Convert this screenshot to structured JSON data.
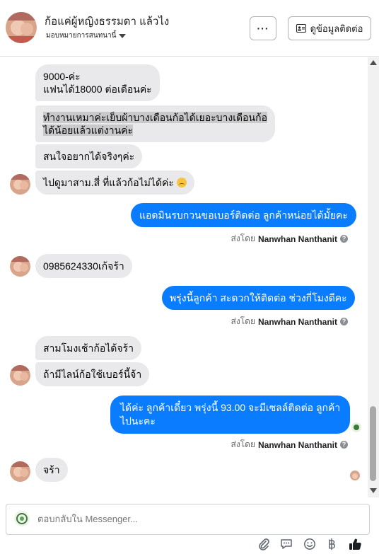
{
  "header": {
    "name": "ก้อแค่ผู้หญิงธรรมดา แล้วไง",
    "subtitle": "มอบหมายการสนทนานี้",
    "more_label": "···",
    "contact_label": "ดูข้อมูลติดต่อ"
  },
  "messages": {
    "m1_line1": "9000-ค่ะ",
    "m1_line2": "แฟนได้18000 ต่อเดือนค่ะ",
    "m2_line1": "ทำงานเหมาค่ะเย็บผ้าบางเดือนก้อได้เยอะบางเดือนก้อ",
    "m2_line2": "ได้น้อยแล้วแต่งานค่ะ",
    "m3": "สนใจอยากได้จริงๆค่ะ",
    "m4": "ไปดูมาสาม.สี่  ที่แล้วก้อไม่ได้ค่ะ",
    "m5": "แอดมินรบกวนขอเบอร์ติดต่อ ลูกค้าหน่อยได้มั้ยคะ",
    "m6": "0985624330เก้จร้า",
    "m7": "พรุ่งนี้ลูกค้า สะดวกให้ติดต่อ ช่วงกี่โมงดีคะ",
    "m8": "สามโมงเช้าก้อได้จร้า",
    "m9": "ถ้ามีไลน์ก้อใช้เบอร์นี้จ้า",
    "m10_line1": "ได้ค่ะ ลูกค้าเดี๋ยว  พรุ่งนี้ 93.00 จะมีเซลล์ติดต่อ ลูกค้า",
    "m10_line2": "ไปนะคะ",
    "m11": "จร้า"
  },
  "sent_by": {
    "prefix": "ส่งโดย",
    "name": "Nanwhan Nanthanit"
  },
  "composer": {
    "placeholder": "ตอบกลับใน Messenger..."
  },
  "icons": {
    "attach": "paperclip-icon",
    "gif": "speech-bubble-icon",
    "emoji": "smiley-icon",
    "baht": "baht-icon",
    "like": "thumbs-up-icon"
  },
  "colors": {
    "outgoing": "#0a7cff",
    "incoming": "#e9e9eb"
  }
}
